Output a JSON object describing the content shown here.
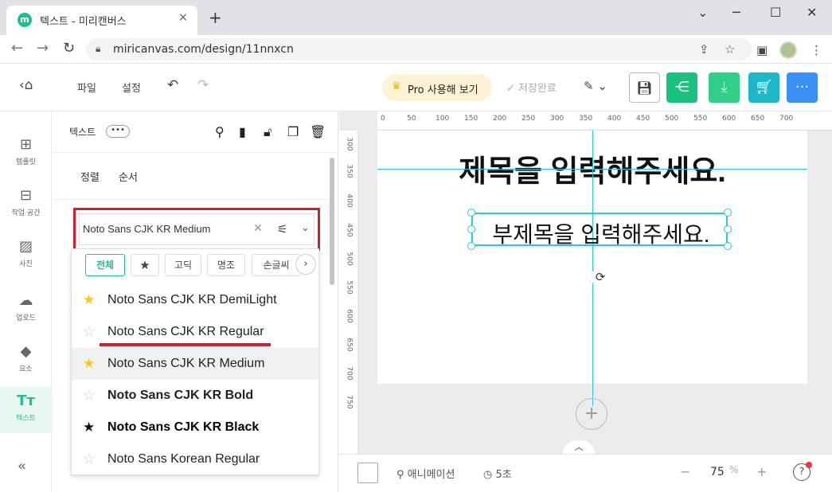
{
  "browser": {
    "tab_title": "텍스트 - 미리캔버스",
    "favicon_letter": "m",
    "tab_close": "×",
    "new_tab": "+",
    "url": "miricanvas.com/design/11nnxcn",
    "window_controls": [
      "⌄",
      "─",
      "☐",
      "✕"
    ]
  },
  "toolbar": {
    "file_label": "파일",
    "settings_label": "설정",
    "pro_label": "Pro 사용해 보기",
    "save_status": "저장완료",
    "colors": {
      "share": "#19c37d",
      "download": "#2fcf88",
      "cart": "#1cb8c9",
      "more": "#3b8ff5"
    }
  },
  "rail": {
    "items": [
      {
        "label": "템플릿",
        "icon": "template-icon"
      },
      {
        "label": "작업 공간",
        "icon": "workspace-icon"
      },
      {
        "label": "사진",
        "icon": "photo-icon"
      },
      {
        "label": "업로드",
        "icon": "upload-icon"
      },
      {
        "label": "요소",
        "icon": "elements-icon"
      },
      {
        "label": "텍스트",
        "icon": "text-icon"
      }
    ],
    "collapse": "«"
  },
  "panel": {
    "title": "텍스트",
    "more": "•••",
    "tabs": {
      "align": "정렬",
      "order": "순서"
    }
  },
  "font_picker": {
    "current_value": "Noto Sans CJK KR Medium",
    "chips": [
      "전체",
      "★",
      "고딕",
      "명조",
      "손글씨"
    ],
    "fonts": [
      {
        "name": "Noto Sans CJK KR DemiLight",
        "starred": true
      },
      {
        "name": "Noto Sans CJK KR Regular",
        "starred": false
      },
      {
        "name": "Noto Sans CJK KR Medium",
        "starred": true
      },
      {
        "name": "Noto Sans CJK KR Bold",
        "starred": false
      },
      {
        "name": "Noto Sans CJK KR Black",
        "starred": true
      },
      {
        "name": "Noto Sans Korean Regular",
        "starred": false
      }
    ],
    "highlight_color": "#d0202e"
  },
  "canvas": {
    "title": "제목을 입력해주세요.",
    "subtitle": "부제목을 입력해주세요.",
    "ruler_top": [
      "0",
      "50",
      "100",
      "150",
      "200",
      "250",
      "300",
      "350",
      "400",
      "450",
      "500",
      "550",
      "600",
      "650",
      "700"
    ],
    "ruler_left": [
      "300",
      "350",
      "400",
      "450",
      "500",
      "550",
      "600",
      "650",
      "700",
      "750"
    ],
    "guide_color": "#29c9d6"
  },
  "bottom": {
    "animation_label": "애니메이션",
    "duration_label": "5초",
    "zoom_value": "75",
    "zoom_unit": "%",
    "zoom_minus": "−",
    "zoom_plus": "+",
    "help": "?"
  }
}
